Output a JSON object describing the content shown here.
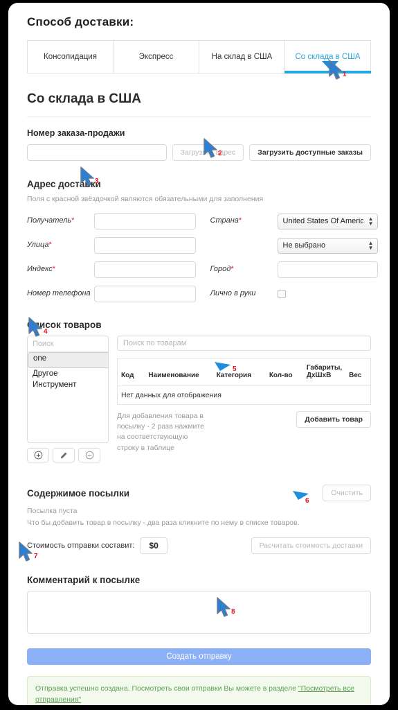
{
  "page": {
    "method_heading": "Способ доставки:",
    "section_title": "Со склада в США"
  },
  "tabs": [
    {
      "label": "Консолидация",
      "active": false
    },
    {
      "label": "Экспресс",
      "active": false
    },
    {
      "label": "На склад в США",
      "active": false
    },
    {
      "label": "Со склада в США",
      "active": true
    }
  ],
  "order": {
    "heading": "Номер заказа-продажи",
    "input_value": "",
    "input_placeholder": "",
    "load_address_label": "Загрузить адрес",
    "load_orders_label": "Загрузить доступные заказы"
  },
  "address": {
    "heading": "Адрес доставки",
    "hint": "Поля с красной звёздочкой являются обязательными для заполнения",
    "fields": {
      "recipient_label": "Получатель",
      "street_label": "Улица",
      "index_label": "Индекс",
      "phone_label": "Номер телефона",
      "country_label": "Страна",
      "city_label": "Город",
      "in_hands_label": "Лично в руки",
      "required_mark": "*"
    },
    "values": {
      "recipient": "",
      "street": "",
      "index": "",
      "phone": "",
      "city": "",
      "country_selected": "United States Of America",
      "state_selected": "Не выбрано",
      "in_hands_checked": false
    }
  },
  "goods": {
    "heading": "Список товаров",
    "search_placeholder": "Поиск",
    "search_value": "",
    "categories": [
      {
        "label": "one",
        "selected": true
      },
      {
        "label": "Другое",
        "selected": false
      },
      {
        "label": "Инструмент",
        "selected": false
      }
    ],
    "icon_buttons": [
      {
        "name": "add-category-button",
        "glyph": "⊕"
      },
      {
        "name": "edit-category-button",
        "glyph": "✎"
      },
      {
        "name": "remove-category-button",
        "glyph": "⊖"
      }
    ],
    "table_search_placeholder": "Поиск по товарам",
    "table_search_value": "",
    "columns": [
      "Код",
      "Наименование",
      "Категория",
      "Кол-во",
      "Габариты, ДхШхВ",
      "Вес"
    ],
    "empty_row": "Нет данных для отображения",
    "note": "Для добавления товара в посылку - 2 раза нажмите на соответствующую строку в таблице",
    "add_item_label": "Добавить товар"
  },
  "parcel": {
    "heading": "Содержимое посылки",
    "clear_label": "Очистить",
    "empty_line1": "Посылка пуста",
    "empty_line2": "Что бы добавить товар в посылку - два раза кликните по нему в списке товаров.",
    "cost_label": "Стоимость отправки составит:",
    "cost_value": "$0",
    "calc_label": "Расчитать стоимость доставки"
  },
  "comment": {
    "heading": "Комментарий к посылке",
    "value": "",
    "placeholder": ""
  },
  "submit": {
    "label": "Создать отправку"
  },
  "alert": {
    "text_before": "Отправка успешно создана. Посмотреть свои отправки Вы можете в разделе ",
    "link_text": "\"Посмотреть все отправления\""
  },
  "annotations": [
    {
      "num": "1"
    },
    {
      "num": "2"
    },
    {
      "num": "3"
    },
    {
      "num": "4"
    },
    {
      "num": "5"
    },
    {
      "num": "6"
    },
    {
      "num": "7"
    },
    {
      "num": "8"
    }
  ],
  "colors": {
    "accent_tab": "#23a9e0",
    "submit_bg": "#8cb0f5",
    "alert_text": "#5aa152",
    "alert_bg": "#f3f9ec",
    "required": "#e8202a",
    "annotation": "#e8121a",
    "cursor": "#1f6fd0"
  }
}
